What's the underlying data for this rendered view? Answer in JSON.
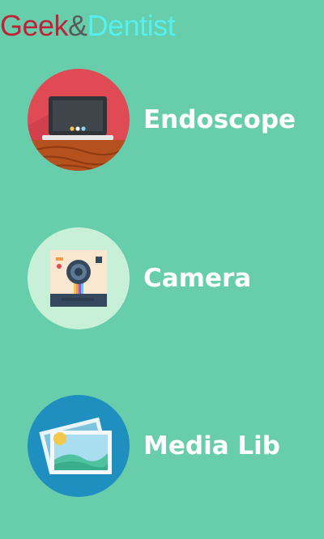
{
  "app": {
    "title_parts": [
      {
        "text": "Geek",
        "color": "#C0223A"
      },
      {
        "text": "&",
        "color": "#5A5A5A"
      },
      {
        "text": "Dentist",
        "color": "#55F0F0"
      }
    ]
  },
  "colors": {
    "background": "#67CDAA",
    "label": "#FFFFFF"
  },
  "menu": {
    "items": [
      {
        "label": "Endoscope",
        "icon": "laptop-on-desk-icon",
        "icon_bg": "#E04A55"
      },
      {
        "label": "Camera",
        "icon": "instant-camera-icon",
        "icon_bg": "#C8F0D8"
      },
      {
        "label": "Media Lib",
        "icon": "photo-gallery-icon",
        "icon_bg": "#1F8FC0"
      }
    ]
  }
}
